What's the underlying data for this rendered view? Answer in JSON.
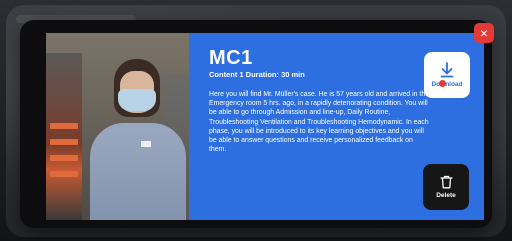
{
  "modal": {
    "close_label": "×",
    "title": "MC1",
    "subtitle": "Content 1 Duration: 30 min",
    "description": "Here you will find Mr. Müller's case. He is 57 years old and arrived in the Emergency room 5 hrs. ago, in a rapidly deteriorating condition. You will be able to go through Admission and line-up, Daily Routine, Troubleshooting Ventilation and Troubleshooting Hemodynamic. In each phase, you will be introduced to its key learning objectives and you will be able to answer questions and receive personalized feedback on them.",
    "download_label": "Download",
    "delete_label": "Delete"
  },
  "icons": {
    "close": "close-icon",
    "download": "download-icon",
    "delete": "trash-icon"
  },
  "colors": {
    "card_blue": "#2d6fe0",
    "close_red": "#e53935",
    "modal_dark": "#0d0d0f",
    "delete_dark": "#161616"
  }
}
